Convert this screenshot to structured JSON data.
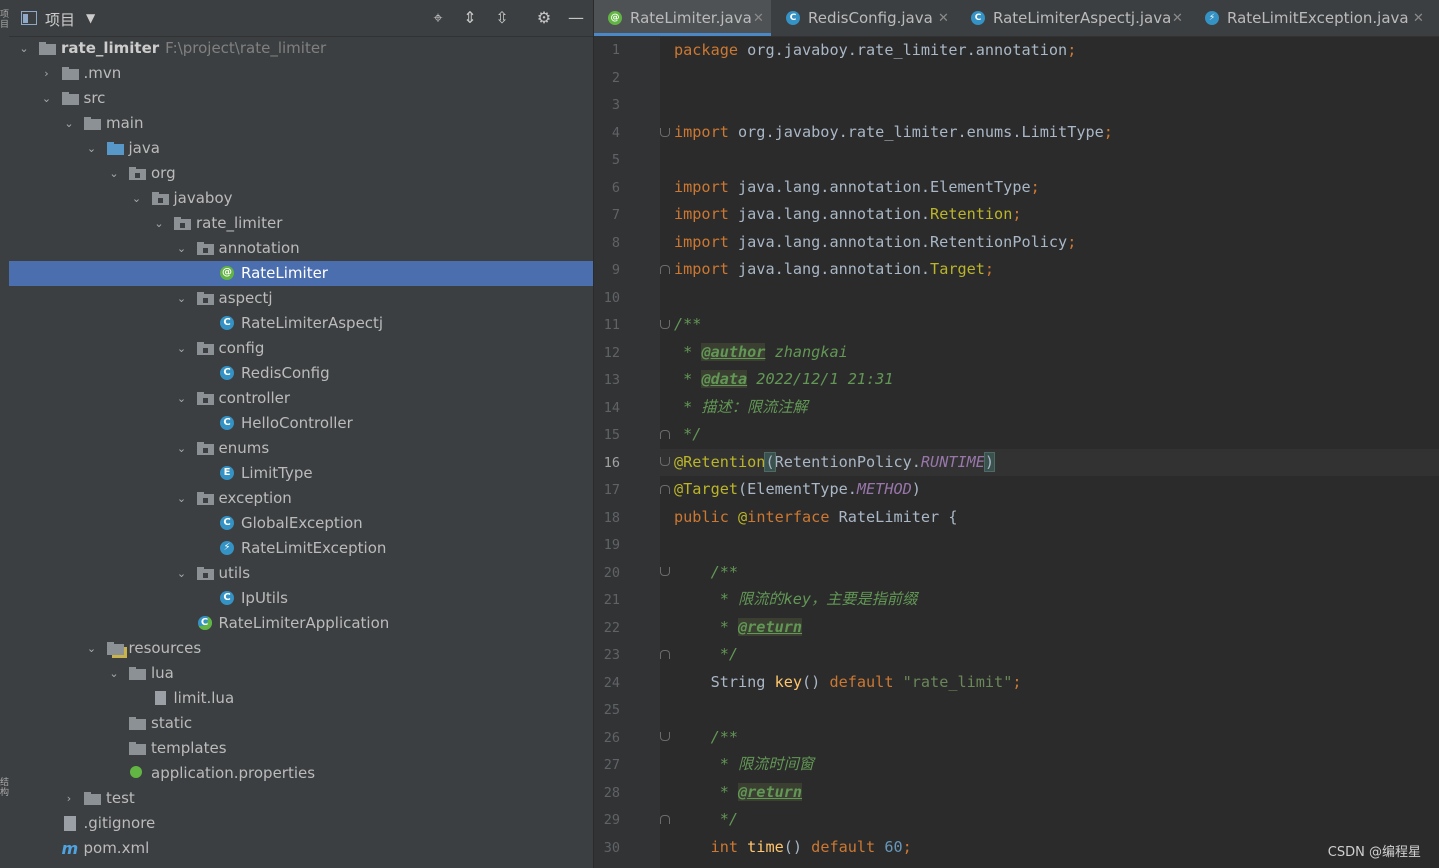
{
  "left_strip": {
    "top_text": "项目",
    "bottom_text": "结构"
  },
  "project_panel": {
    "title": "项目",
    "tree": [
      {
        "label": "rate_limiter",
        "path": "F:\\project\\rate_limiter",
        "icon": "folder-icon",
        "expanded": true
      },
      {
        "label": ".mvn",
        "icon": "folder-icon",
        "expanded": false
      },
      {
        "label": "src",
        "icon": "folder-icon",
        "expanded": true
      },
      {
        "label": "main",
        "icon": "folder-icon",
        "expanded": true
      },
      {
        "label": "java",
        "icon": "source-folder-icon",
        "expanded": true
      },
      {
        "label": "org",
        "icon": "package-icon",
        "expanded": true
      },
      {
        "label": "javaboy",
        "icon": "package-icon",
        "expanded": true
      },
      {
        "label": "rate_limiter",
        "icon": "package-icon",
        "expanded": true
      },
      {
        "label": "annotation",
        "icon": "package-icon",
        "expanded": true
      },
      {
        "label": "RateLimiter",
        "icon": "annotation-icon",
        "selected": true
      },
      {
        "label": "aspectj",
        "icon": "package-icon",
        "expanded": true
      },
      {
        "label": "RateLimiterAspectj",
        "icon": "class-icon"
      },
      {
        "label": "config",
        "icon": "package-icon",
        "expanded": true
      },
      {
        "label": "RedisConfig",
        "icon": "class-icon"
      },
      {
        "label": "controller",
        "icon": "package-icon",
        "expanded": true
      },
      {
        "label": "HelloController",
        "icon": "class-icon"
      },
      {
        "label": "enums",
        "icon": "package-icon",
        "expanded": true
      },
      {
        "label": "LimitType",
        "icon": "enum-icon"
      },
      {
        "label": "exception",
        "icon": "package-icon",
        "expanded": true
      },
      {
        "label": "GlobalException",
        "icon": "class-icon"
      },
      {
        "label": "RateLimitException",
        "icon": "exception-icon"
      },
      {
        "label": "utils",
        "icon": "package-icon",
        "expanded": true
      },
      {
        "label": "IpUtils",
        "icon": "class-icon"
      },
      {
        "label": "RateLimiterApplication",
        "icon": "spring-app-icon"
      },
      {
        "label": "resources",
        "icon": "resources-folder-icon",
        "expanded": true
      },
      {
        "label": "lua",
        "icon": "folder-icon",
        "expanded": true
      },
      {
        "label": "limit.lua",
        "icon": "file-icon"
      },
      {
        "label": "static",
        "icon": "folder-icon"
      },
      {
        "label": "templates",
        "icon": "folder-icon"
      },
      {
        "label": "application.properties",
        "icon": "properties-icon"
      },
      {
        "label": "test",
        "icon": "folder-icon",
        "expanded": false
      },
      {
        "label": ".gitignore",
        "icon": "gitignore-icon"
      },
      {
        "label": "pom.xml",
        "icon": "maven-icon"
      }
    ]
  },
  "tabs": [
    {
      "label": "RateLimiter.java",
      "icon": "annotation-icon",
      "active": true
    },
    {
      "label": "RedisConfig.java",
      "icon": "class-icon"
    },
    {
      "label": "RateLimiterAspectj.java",
      "icon": "class-icon"
    },
    {
      "label": "RateLimitException.java",
      "icon": "exception-icon"
    }
  ],
  "editor": {
    "current_line": 16,
    "lines": [
      "1",
      "2",
      "3",
      "4",
      "5",
      "6",
      "7",
      "8",
      "9",
      "10",
      "11",
      "12",
      "13",
      "14",
      "15",
      "16",
      "17",
      "18",
      "19",
      "20",
      "21",
      "22",
      "23",
      "24",
      "25",
      "26",
      "27",
      "28",
      "29",
      "30"
    ],
    "code": {
      "l1_pkg": "package",
      "l1_name": " org.javaboy.rate_limiter.annotation",
      "imp": "import",
      "l4": " org.javaboy.rate_limiter.enums.LimitType",
      "l6": " java.lang.annotation.ElementType",
      "l7a": " java.lang.annotation.",
      "l7b": "Retention",
      "l8": " java.lang.annotation.RetentionPolicy",
      "l9a": " java.lang.annotation.",
      "l9b": "Target",
      "l11": "/**",
      "l12a": " * ",
      "l12tag": "@author",
      "l12b": " zhangkai",
      "l13a": " * ",
      "l13tag": "@data",
      "l13b": " 2022/12/1 21:31",
      "l14": " * 描述：限流注解",
      "l15": " */",
      "l16a": "@Retention",
      "l16b": "RetentionPolicy.",
      "l16c": "RUNTIME",
      "l17a": "@Target",
      "l17b": "(ElementType.",
      "l17c": "METHOD",
      "l17d": ")",
      "l18a": "public ",
      "l18b": "@",
      "l18c": "interface ",
      "l18d": "RateLimiter {",
      "l20": "    /**",
      "l21": "     * 限流的key，主要是指前缀",
      "l22a": "     * ",
      "l22tag": "@return",
      "l23": "     */",
      "l24a": "    String ",
      "l24b": "key",
      "l24c": "() ",
      "l24d": "default ",
      "l24e": "\"rate_limit\"",
      "l24f": ";",
      "l26": "    /**",
      "l27": "     * 限流时间窗",
      "l28a": "     * ",
      "l28tag": "@return",
      "l29": "     */",
      "l30a": "    int ",
      "l30b": "time",
      "l30c": "() ",
      "l30d": "default ",
      "l30e": "60",
      "l30f": ";"
    }
  },
  "watermark": "CSDN @编程星"
}
